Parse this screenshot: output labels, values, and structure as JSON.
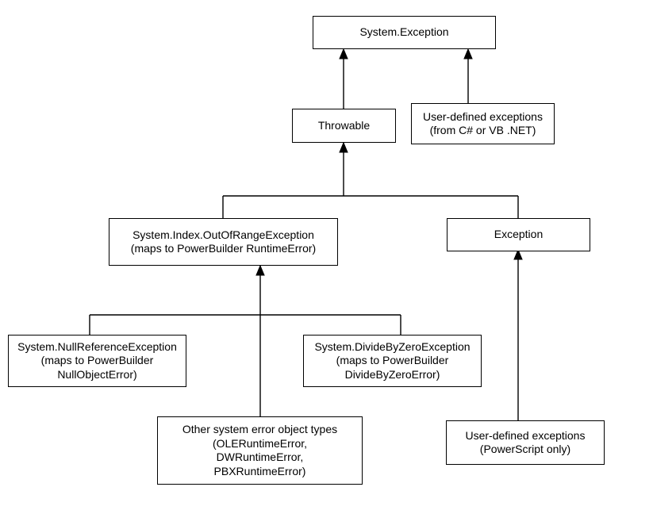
{
  "nodes": {
    "system_exception": "System.Exception",
    "throwable": "Throwable",
    "user_defined_dotnet": "User-defined exceptions\n(from C# or VB .NET)",
    "out_of_range": "System.Index.OutOfRangeException\n(maps to PowerBuilder RuntimeError)",
    "exception": "Exception",
    "null_ref": "System.NullReferenceException\n(maps to PowerBuilder\nNullObjectError)",
    "divide_by_zero": "System.DivideByZeroException\n(maps to PowerBuilder\nDivideByZeroError)",
    "other_types": "Other system error object types\n(OLERuntimeError,\nDWRuntimeError,\nPBXRuntimeError)",
    "user_defined_ps": "User-defined exceptions\n(PowerScript only)"
  }
}
